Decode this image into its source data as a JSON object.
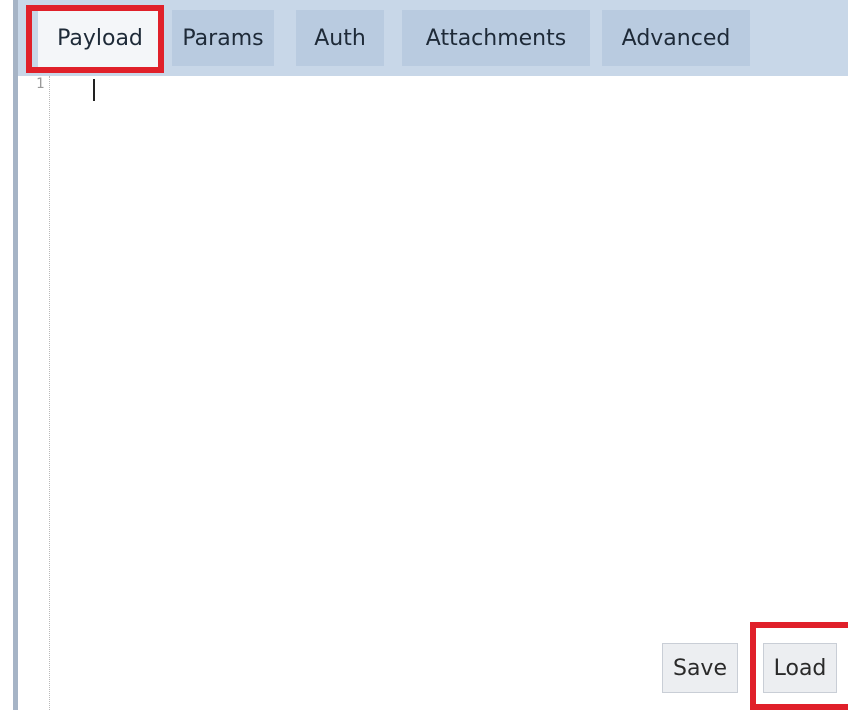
{
  "tabs": {
    "payload": "Payload",
    "params": "Params",
    "auth": "Auth",
    "attachments": "Attachments",
    "advanced": "Advanced",
    "active": "Payload"
  },
  "editor": {
    "line_number": "1",
    "content": ""
  },
  "actions": {
    "save": "Save",
    "load": "Load"
  },
  "colors": {
    "tabbar_bg": "#c8d7e8",
    "tab_bg": "#b9cbe0",
    "active_tab_bg": "#f4f6f9",
    "highlight": "#e0202a"
  }
}
